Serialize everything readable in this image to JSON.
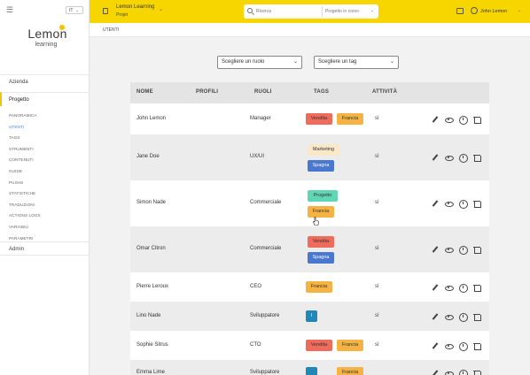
{
  "sidebar": {
    "menu_icon": "hamburger-icon",
    "language": "IT",
    "logo_main": "Lemon",
    "logo_sub": "learning",
    "nav_azienda": "Azienda",
    "nav_progetto": "Progetto",
    "nav_admin": "Admin",
    "sub_items": [
      "PANORAMICA",
      "UTENTI",
      "TAGS",
      "STRUMENTI",
      "CONTENUTI",
      "GUIDE",
      "PUSHS",
      "STATISTICHE",
      "TRADUZIONI",
      "ACTIONS LOGS",
      "VARIABILI",
      "PARAMETRI"
    ],
    "active_sub": "UTENTI"
  },
  "topbar": {
    "project_name": "Lemon Learning",
    "project_type": "Projet",
    "search_placeholder": "Ricerca",
    "search_scope": "Progetto in corso",
    "user_name": "John Lemon",
    "bg_color": "#f7d600"
  },
  "breadcrumb": "UTENTI",
  "filters": {
    "role_select": "Scegliere un ruolo",
    "tag_select": "Scegliere un tag"
  },
  "table": {
    "headers": [
      "NOME",
      "PROFILI",
      "RUOLI",
      "TAGS",
      "ATTIVITÀ"
    ],
    "rows": [
      {
        "name": "John Lemon",
        "role": "Manager",
        "tags": [
          "Vendita",
          "Francia"
        ],
        "activity": "sì"
      },
      {
        "name": "Jane Doe",
        "role": "UX/UI",
        "tags": [
          "Marketing",
          "Spagna"
        ],
        "activity": "sì"
      },
      {
        "name": "Simon Nade",
        "role": "Commerciale",
        "tags": [
          "Progetto",
          "Francia"
        ],
        "activity": "sì"
      },
      {
        "name": "Omar Citron",
        "role": "Commerciale",
        "tags": [
          "Vendita",
          "Spagna"
        ],
        "activity": "sì"
      },
      {
        "name": "Pierre Leroux",
        "role": "CEO",
        "tags": [
          "Francia"
        ],
        "activity": "sì"
      },
      {
        "name": "Lino Nade",
        "role": "Sviluppatore",
        "tags": [
          "I"
        ],
        "activity": "sì"
      },
      {
        "name": "Sophie Sitrus",
        "role": "CTO",
        "tags": [
          "Vendita",
          "Francia"
        ],
        "activity": "sì"
      },
      {
        "name": "Emma Lime",
        "role": "Sviluppatore",
        "tags": [
          "",
          "Francia"
        ],
        "activity": ""
      }
    ]
  },
  "tag_colors": {
    "Vendita": "#ef6b5b",
    "Francia": "#f5b343",
    "Marketing": "#fbe8c8",
    "Spagna": "#4a78d0",
    "Progetto": "#5fd6b4",
    "I": "#1f88b8",
    "": "#1f88b8"
  },
  "row_action_icons": [
    "edit-icon",
    "eye-icon",
    "clock-icon",
    "trash-icon"
  ]
}
